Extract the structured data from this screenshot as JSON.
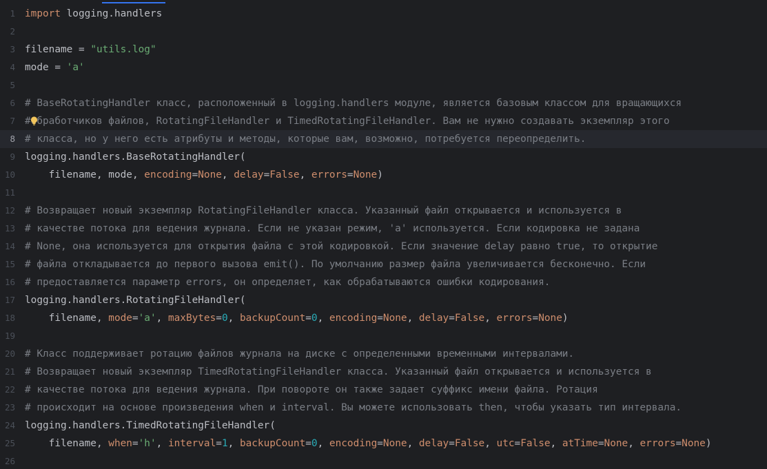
{
  "editor": {
    "accent_color": "#3574f0",
    "lines": [
      {
        "n": "1",
        "tokens": [
          {
            "t": "kw",
            "v": "import"
          },
          {
            "t": "plain",
            "v": " logging.handlers"
          }
        ]
      },
      {
        "n": "2",
        "tokens": []
      },
      {
        "n": "3",
        "tokens": [
          {
            "t": "plain",
            "v": "filename = "
          },
          {
            "t": "str",
            "v": "\"utils.log\""
          }
        ]
      },
      {
        "n": "4",
        "tokens": [
          {
            "t": "plain",
            "v": "mode = "
          },
          {
            "t": "str",
            "v": "'a'"
          }
        ]
      },
      {
        "n": "5",
        "tokens": []
      },
      {
        "n": "6",
        "tokens": [
          {
            "t": "cm",
            "v": "# BaseRotatingHandler класс, расположенный в logging.handlers модуле, является базовым классом для вращающихся"
          }
        ]
      },
      {
        "n": "7",
        "tokens": [
          {
            "t": "cm",
            "v": "#обработчиков файлов, RotatingFileHandler и TimedRotatingFileHandler. Вам не нужно создавать экземпляр этого"
          }
        ],
        "intention": true
      },
      {
        "n": "8",
        "tokens": [
          {
            "t": "cm",
            "v": "# класса, но у него есть атрибуты и методы, которые вам, возможно, потребуется переопределить."
          }
        ],
        "current": true
      },
      {
        "n": "9",
        "tokens": [
          {
            "t": "plain",
            "v": "logging.handlers.BaseRotatingHandler("
          }
        ]
      },
      {
        "n": "10",
        "tokens": [
          {
            "t": "plain",
            "v": "    filename, mode, "
          },
          {
            "t": "param",
            "v": "encoding"
          },
          {
            "t": "plain",
            "v": "="
          },
          {
            "t": "kw",
            "v": "None"
          },
          {
            "t": "plain",
            "v": ", "
          },
          {
            "t": "param",
            "v": "delay"
          },
          {
            "t": "plain",
            "v": "="
          },
          {
            "t": "kw",
            "v": "False"
          },
          {
            "t": "plain",
            "v": ", "
          },
          {
            "t": "param",
            "v": "errors"
          },
          {
            "t": "plain",
            "v": "="
          },
          {
            "t": "kw",
            "v": "None"
          },
          {
            "t": "plain",
            "v": ")"
          }
        ]
      },
      {
        "n": "11",
        "tokens": []
      },
      {
        "n": "12",
        "tokens": [
          {
            "t": "cm",
            "v": "# Возвращает новый экземпляр RotatingFileHandler класса. Указанный файл открывается и используется в"
          }
        ]
      },
      {
        "n": "13",
        "tokens": [
          {
            "t": "cm",
            "v": "# качестве потока для ведения журнала. Если не указан режим, 'a' используется. Если кодировка не задана"
          }
        ]
      },
      {
        "n": "14",
        "tokens": [
          {
            "t": "cm",
            "v": "# None, она используется для открытия файла с этой кодировкой. Если значение delay равно true, то открытие"
          }
        ]
      },
      {
        "n": "15",
        "tokens": [
          {
            "t": "cm",
            "v": "# файла откладывается до первого вызова emit(). По умолчанию размер файла увеличивается бесконечно. Если"
          }
        ]
      },
      {
        "n": "16",
        "tokens": [
          {
            "t": "cm",
            "v": "# предоставляется параметр errors, он определяет, как обрабатываются ошибки кодирования."
          }
        ]
      },
      {
        "n": "17",
        "tokens": [
          {
            "t": "plain",
            "v": "logging.handlers.RotatingFileHandler("
          }
        ]
      },
      {
        "n": "18",
        "tokens": [
          {
            "t": "plain",
            "v": "    filename, "
          },
          {
            "t": "param",
            "v": "mode"
          },
          {
            "t": "plain",
            "v": "="
          },
          {
            "t": "str",
            "v": "'a'"
          },
          {
            "t": "plain",
            "v": ", "
          },
          {
            "t": "param",
            "v": "maxBytes"
          },
          {
            "t": "plain",
            "v": "="
          },
          {
            "t": "num",
            "v": "0"
          },
          {
            "t": "plain",
            "v": ", "
          },
          {
            "t": "param",
            "v": "backupCount"
          },
          {
            "t": "plain",
            "v": "="
          },
          {
            "t": "num",
            "v": "0"
          },
          {
            "t": "plain",
            "v": ", "
          },
          {
            "t": "param",
            "v": "encoding"
          },
          {
            "t": "plain",
            "v": "="
          },
          {
            "t": "kw",
            "v": "None"
          },
          {
            "t": "plain",
            "v": ", "
          },
          {
            "t": "param",
            "v": "delay"
          },
          {
            "t": "plain",
            "v": "="
          },
          {
            "t": "kw",
            "v": "False"
          },
          {
            "t": "plain",
            "v": ", "
          },
          {
            "t": "param",
            "v": "errors"
          },
          {
            "t": "plain",
            "v": "="
          },
          {
            "t": "kw",
            "v": "None"
          },
          {
            "t": "plain",
            "v": ")"
          }
        ]
      },
      {
        "n": "19",
        "tokens": []
      },
      {
        "n": "20",
        "tokens": [
          {
            "t": "cm",
            "v": "# Класс поддерживает ротацию файлов журнала на диске с определенными временными интервалами."
          }
        ]
      },
      {
        "n": "21",
        "tokens": [
          {
            "t": "cm",
            "v": "# Возвращает новый экземпляр TimedRotatingFileHandler класса. Указанный файл открывается и используется в"
          }
        ]
      },
      {
        "n": "22",
        "tokens": [
          {
            "t": "cm",
            "v": "# качестве потока для ведения журнала. При повороте он также задает суффикс имени файла. Ротация"
          }
        ]
      },
      {
        "n": "23",
        "tokens": [
          {
            "t": "cm",
            "v": "# происходит на основе произведения when и interval. Вы можете использовать then, чтобы указать тип интервала."
          }
        ]
      },
      {
        "n": "24",
        "tokens": [
          {
            "t": "plain",
            "v": "logging.handlers.TimedRotatingFileHandler("
          }
        ]
      },
      {
        "n": "25",
        "tokens": [
          {
            "t": "plain",
            "v": "    filename, "
          },
          {
            "t": "param",
            "v": "when"
          },
          {
            "t": "plain",
            "v": "="
          },
          {
            "t": "str",
            "v": "'h'"
          },
          {
            "t": "plain",
            "v": ", "
          },
          {
            "t": "param",
            "v": "interval"
          },
          {
            "t": "plain",
            "v": "="
          },
          {
            "t": "num",
            "v": "1"
          },
          {
            "t": "plain",
            "v": ", "
          },
          {
            "t": "param",
            "v": "backupCount"
          },
          {
            "t": "plain",
            "v": "="
          },
          {
            "t": "num",
            "v": "0"
          },
          {
            "t": "plain",
            "v": ", "
          },
          {
            "t": "param",
            "v": "encoding"
          },
          {
            "t": "plain",
            "v": "="
          },
          {
            "t": "kw",
            "v": "None"
          },
          {
            "t": "plain",
            "v": ", "
          },
          {
            "t": "param",
            "v": "delay"
          },
          {
            "t": "plain",
            "v": "="
          },
          {
            "t": "kw",
            "v": "False"
          },
          {
            "t": "plain",
            "v": ", "
          },
          {
            "t": "param",
            "v": "utc"
          },
          {
            "t": "plain",
            "v": "="
          },
          {
            "t": "kw",
            "v": "False"
          },
          {
            "t": "plain",
            "v": ", "
          },
          {
            "t": "param",
            "v": "atTime"
          },
          {
            "t": "plain",
            "v": "="
          },
          {
            "t": "kw",
            "v": "None"
          },
          {
            "t": "plain",
            "v": ", "
          },
          {
            "t": "param",
            "v": "errors"
          },
          {
            "t": "plain",
            "v": "="
          },
          {
            "t": "kw",
            "v": "None"
          },
          {
            "t": "plain",
            "v": ")"
          }
        ]
      },
      {
        "n": "26",
        "tokens": []
      }
    ],
    "intention_icon": "lightbulb-icon"
  }
}
